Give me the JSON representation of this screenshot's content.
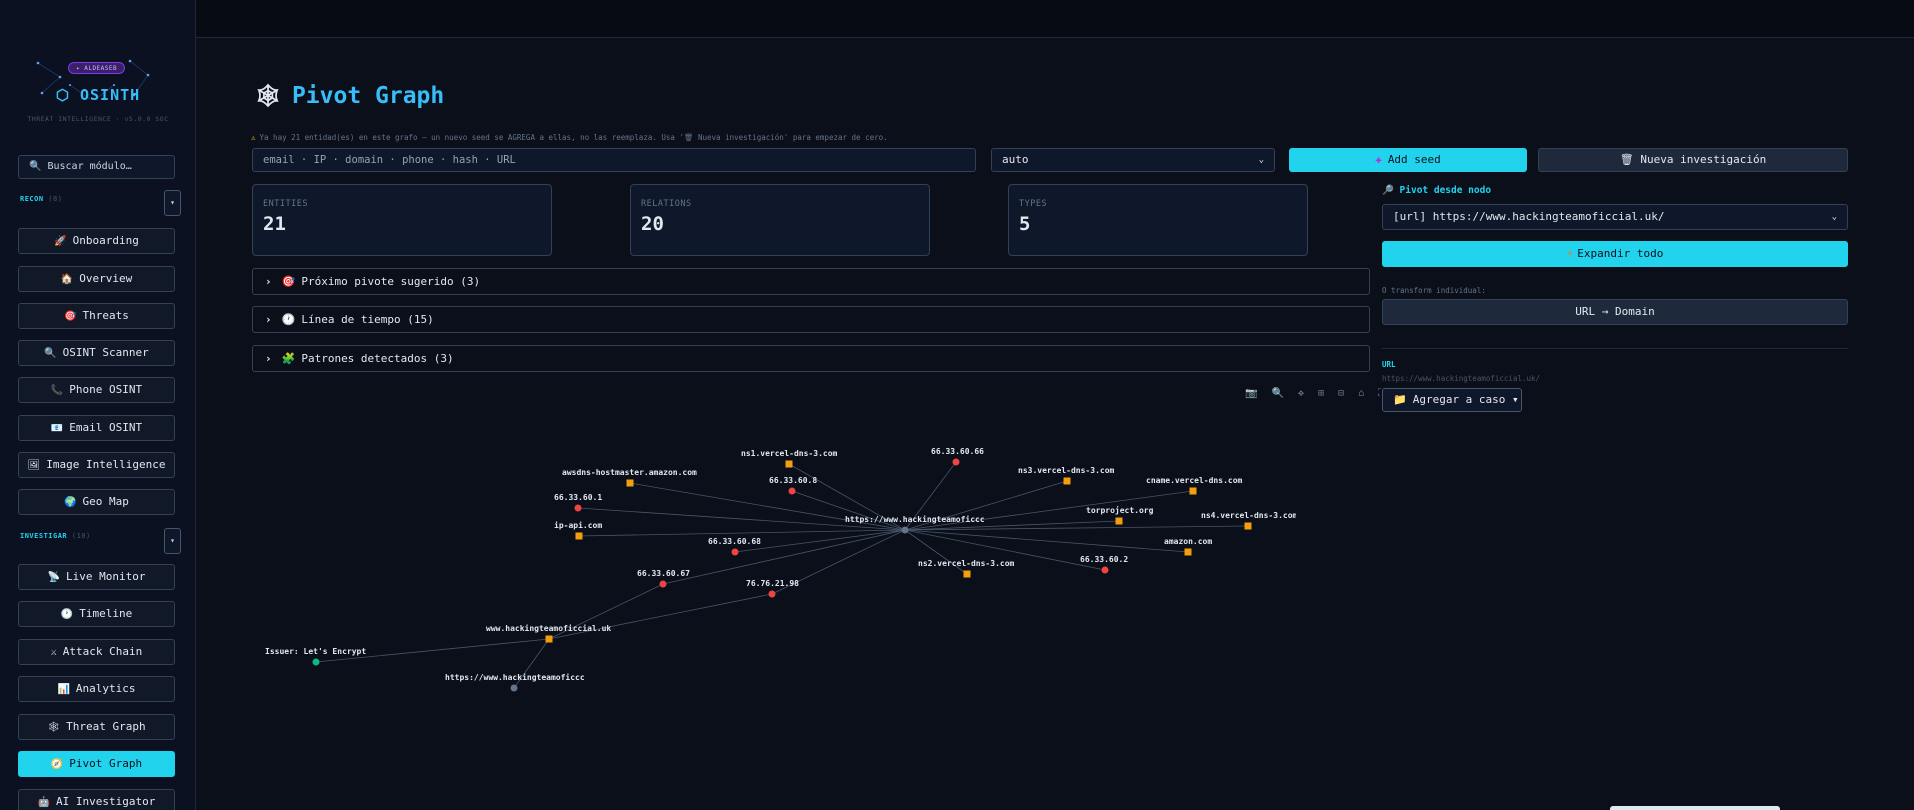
{
  "sidebar": {
    "logo_badge": "✦ ALDEASEB",
    "logo_text": "⬡ OSINTH",
    "logo_sub": "THREAT INTELLIGENCE · v5.0.0 SOC",
    "search_placeholder": "🔍 Buscar módulo…",
    "recon_label": "RECON",
    "recon_count": "(8)",
    "investigar_label": "INVESTIGAR",
    "investigar_count": "(10)",
    "collapse_glyph": "▾",
    "recon_items": [
      {
        "icon": "🚀",
        "label": "Onboarding"
      },
      {
        "icon": "🏠",
        "label": "Overview"
      },
      {
        "icon": "🎯",
        "label": "Threats"
      },
      {
        "icon": "🔍",
        "label": "OSINT Scanner"
      },
      {
        "icon": "📞",
        "label": "Phone OSINT"
      },
      {
        "icon": "📧",
        "label": "Email OSINT"
      },
      {
        "icon": "🖼",
        "label": "Image Intelligence"
      },
      {
        "icon": "🌍",
        "label": "Geo Map"
      }
    ],
    "investigar_items": [
      {
        "icon": "📡",
        "label": "Live Monitor"
      },
      {
        "icon": "🕐",
        "label": "Timeline"
      },
      {
        "icon": "⚔",
        "label": "Attack Chain"
      },
      {
        "icon": "📊",
        "label": "Analytics"
      },
      {
        "icon": "🕸",
        "label": "Threat Graph"
      },
      {
        "icon": "🧭",
        "label": "Pivot Graph"
      },
      {
        "icon": "🤖",
        "label": "AI Investigator"
      }
    ]
  },
  "page": {
    "title_icon": "🕸",
    "title": "Pivot Graph",
    "warning_icon": "⚠",
    "warning": "Ya hay 21 entidad(es) en este grafo — un nuevo seed se AGREGA a ellas, no las reemplaza. Usa '🗑 Nueva investigación' para empezar de cero.",
    "seed_placeholder": "email · IP · domain · phone · hash · URL",
    "type_select": "auto",
    "add_seed_icon": "✚",
    "add_seed": "Add seed",
    "new_investigation": "🗑 Nueva investigación"
  },
  "stats": [
    {
      "label": "ENTITIES",
      "value": "21"
    },
    {
      "label": "RELATIONS",
      "value": "20"
    },
    {
      "label": "TYPES",
      "value": "5"
    }
  ],
  "accordions": [
    {
      "icon": "🎯",
      "label": "Próximo pivote sugerido (3)"
    },
    {
      "icon": "🕐",
      "label": "Línea de tiempo (15)"
    },
    {
      "icon": "🧩",
      "label": "Patrones detectados (3)"
    }
  ],
  "graph_toolbar": "📷 🔍 ✥ ⊞ ⊟ ⌂ ⛶",
  "side_panel": {
    "pivot_title": "🔎 Pivot desde nodo",
    "node_selected": "[url] https://www.hackingteamoficcial.uk/",
    "expand_icon": "⚡",
    "expand_all": "Expandir todo",
    "transform_label": "O transform individual:",
    "transform_button": "URL → Domain",
    "url_label": "URL",
    "url_value": "https://www.hackingteamoficcial.uk/",
    "case_icon": "📁",
    "add_to_case": "Agregar a caso ▾"
  },
  "graph": {
    "colors": {
      "ip": "#ef4444",
      "domain": "#f59e0b",
      "url": "#64748b",
      "cert": "#10b981",
      "edge": "#475569"
    },
    "nodes": [
      {
        "id": "center",
        "label": "https://www.hackingteamoficcc",
        "type": "url"
      },
      {
        "id": "ns1",
        "label": "ns1.vercel-dns-3.com",
        "type": "domain"
      },
      {
        "id": "ip66",
        "label": "66.33.60.66",
        "type": "ip"
      },
      {
        "id": "aws",
        "label": "awsdns-hostmaster.amazon.com",
        "type": "domain"
      },
      {
        "id": "ip8",
        "label": "66.33.60.8",
        "type": "ip"
      },
      {
        "id": "ns3",
        "label": "ns3.vercel-dns-3.com",
        "type": "domain"
      },
      {
        "id": "cname",
        "label": "cname.vercel-dns.com",
        "type": "domain"
      },
      {
        "id": "ip1",
        "label": "66.33.60.1",
        "type": "ip"
      },
      {
        "id": "tor",
        "label": "torproject.org",
        "type": "domain"
      },
      {
        "id": "ns4",
        "label": "ns4.vercel-dns-3.com",
        "type": "domain"
      },
      {
        "id": "ipapi",
        "label": "ip-api.com",
        "type": "domain"
      },
      {
        "id": "ip68",
        "label": "66.33.60.68",
        "type": "ip"
      },
      {
        "id": "amazon",
        "label": "amazon.com",
        "type": "domain"
      },
      {
        "id": "ns2",
        "label": "ns2.vercel-dns-3.com",
        "type": "domain"
      },
      {
        "id": "ip2",
        "label": "66.33.60.2",
        "type": "ip"
      },
      {
        "id": "ip67",
        "label": "66.33.60.67",
        "type": "ip"
      },
      {
        "id": "ip98",
        "label": "76.76.21.98",
        "type": "ip"
      },
      {
        "id": "www",
        "label": "www.hackingteamoficcial.uk",
        "type": "domain"
      },
      {
        "id": "issuer",
        "label": "Issuer: Let's Encrypt",
        "type": "cert"
      },
      {
        "id": "url2",
        "label": "https://www.hackingteamoficcc",
        "type": "url"
      }
    ]
  }
}
